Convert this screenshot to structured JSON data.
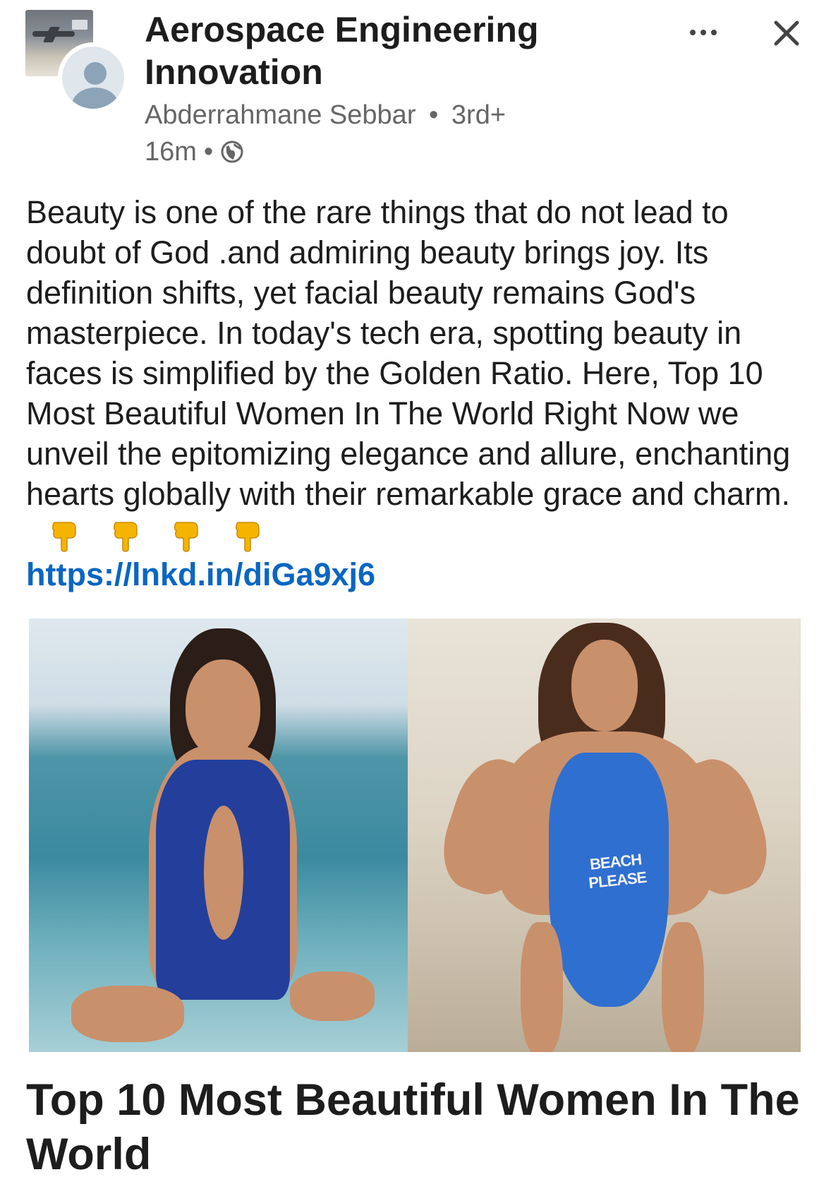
{
  "header": {
    "group_name": "Aerospace Engineering Innovation",
    "author": "Abderrahmane Sebbar",
    "separator": "•",
    "connection_degree": "3rd+",
    "time_ago": "16m",
    "visibility_icon": "globe-icon",
    "more_icon": "more-options-icon",
    "close_icon": "close-icon"
  },
  "post": {
    "text": "Beauty is one of the rare things that do not lead to doubt of God .and admiring beauty brings joy. Its definition shifts, yet facial beauty remains God's masterpiece. In today's tech era, spotting beauty in faces is simplified by the Golden Ratio. Here, Top 10 Most Beautiful Women In The World Right Now we unveil the epitomizing elegance and allure, enchanting hearts globally with their remarkable grace and charm.",
    "emoji_icon": "backhand-index-pointing-down-icon",
    "emoji_count": 4,
    "link": "https://lnkd.in/diGa9xj6"
  },
  "link_preview": {
    "image_left": "woman-in-pool-photo",
    "image_right": "woman-in-blue-swimsuit-photo",
    "swimsuit_text": "BEACH PLEASE",
    "title": "Top 10 Most Beautiful Women In The World"
  },
  "colors": {
    "link": "#0a66c2",
    "text": "#1d1d1d",
    "muted": "#666666"
  }
}
